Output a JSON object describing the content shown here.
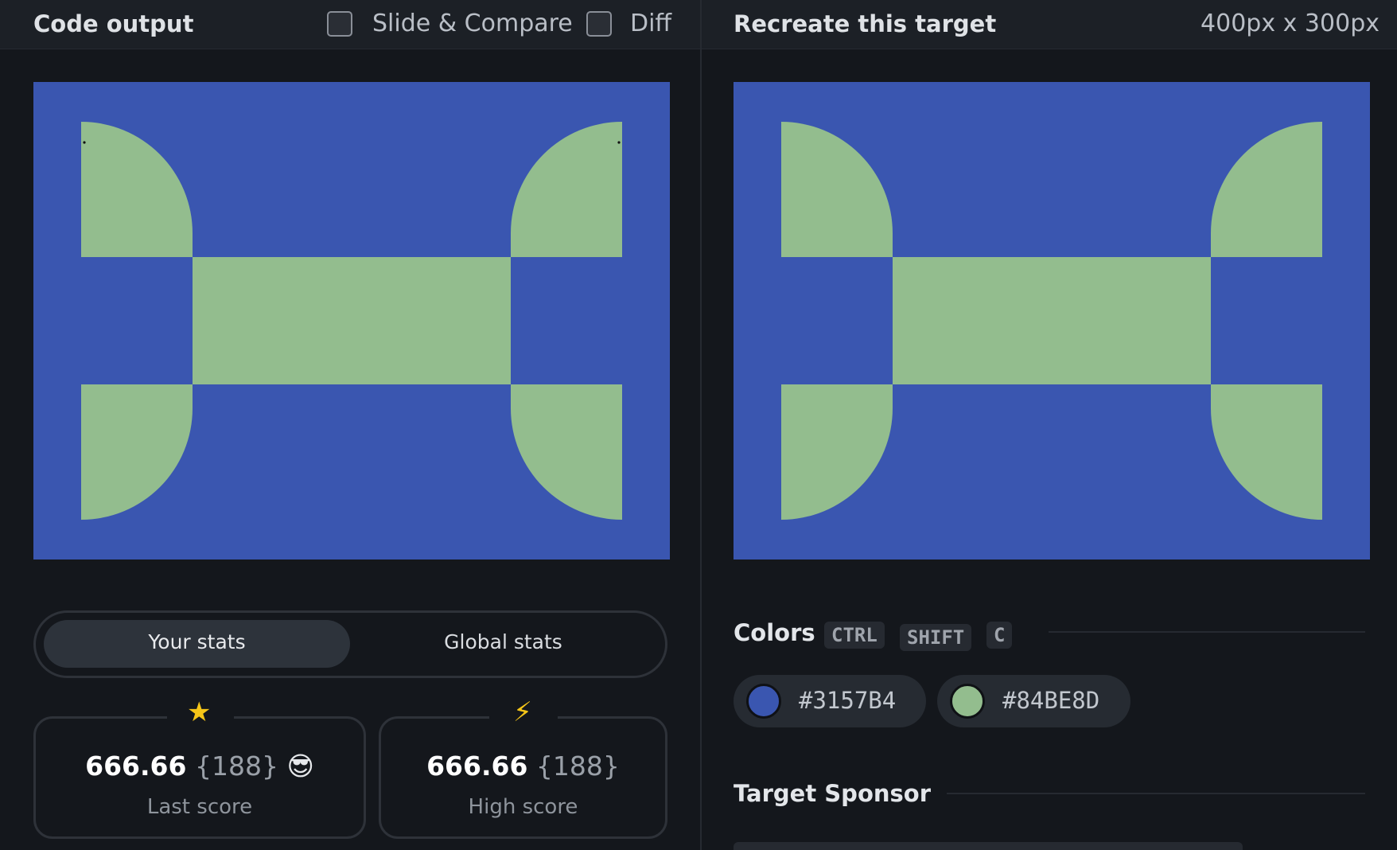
{
  "left": {
    "title": "Code output",
    "slide_compare_label": "Slide & Compare",
    "diff_label": "Diff",
    "stats_tabs": [
      "Your stats",
      "Global stats"
    ],
    "cards": [
      {
        "icon": "star-icon",
        "score": "666.66",
        "chars": "{188}",
        "emoji": "😎",
        "caption": "Last score"
      },
      {
        "icon": "lightning-icon",
        "score": "666.66",
        "chars": "{188}",
        "caption": "High score"
      }
    ]
  },
  "right": {
    "title": "Recreate this target",
    "dimensions": "400px x 300px",
    "colors_heading": "Colors",
    "shortcut": [
      "CTRL",
      "SHIFT",
      "C"
    ],
    "colors": [
      "#3157B4",
      "#84BE8D"
    ],
    "sponsor_heading": "Target Sponsor"
  },
  "palette": {
    "blue": "#3a56b0",
    "green": "#93bd8e"
  }
}
